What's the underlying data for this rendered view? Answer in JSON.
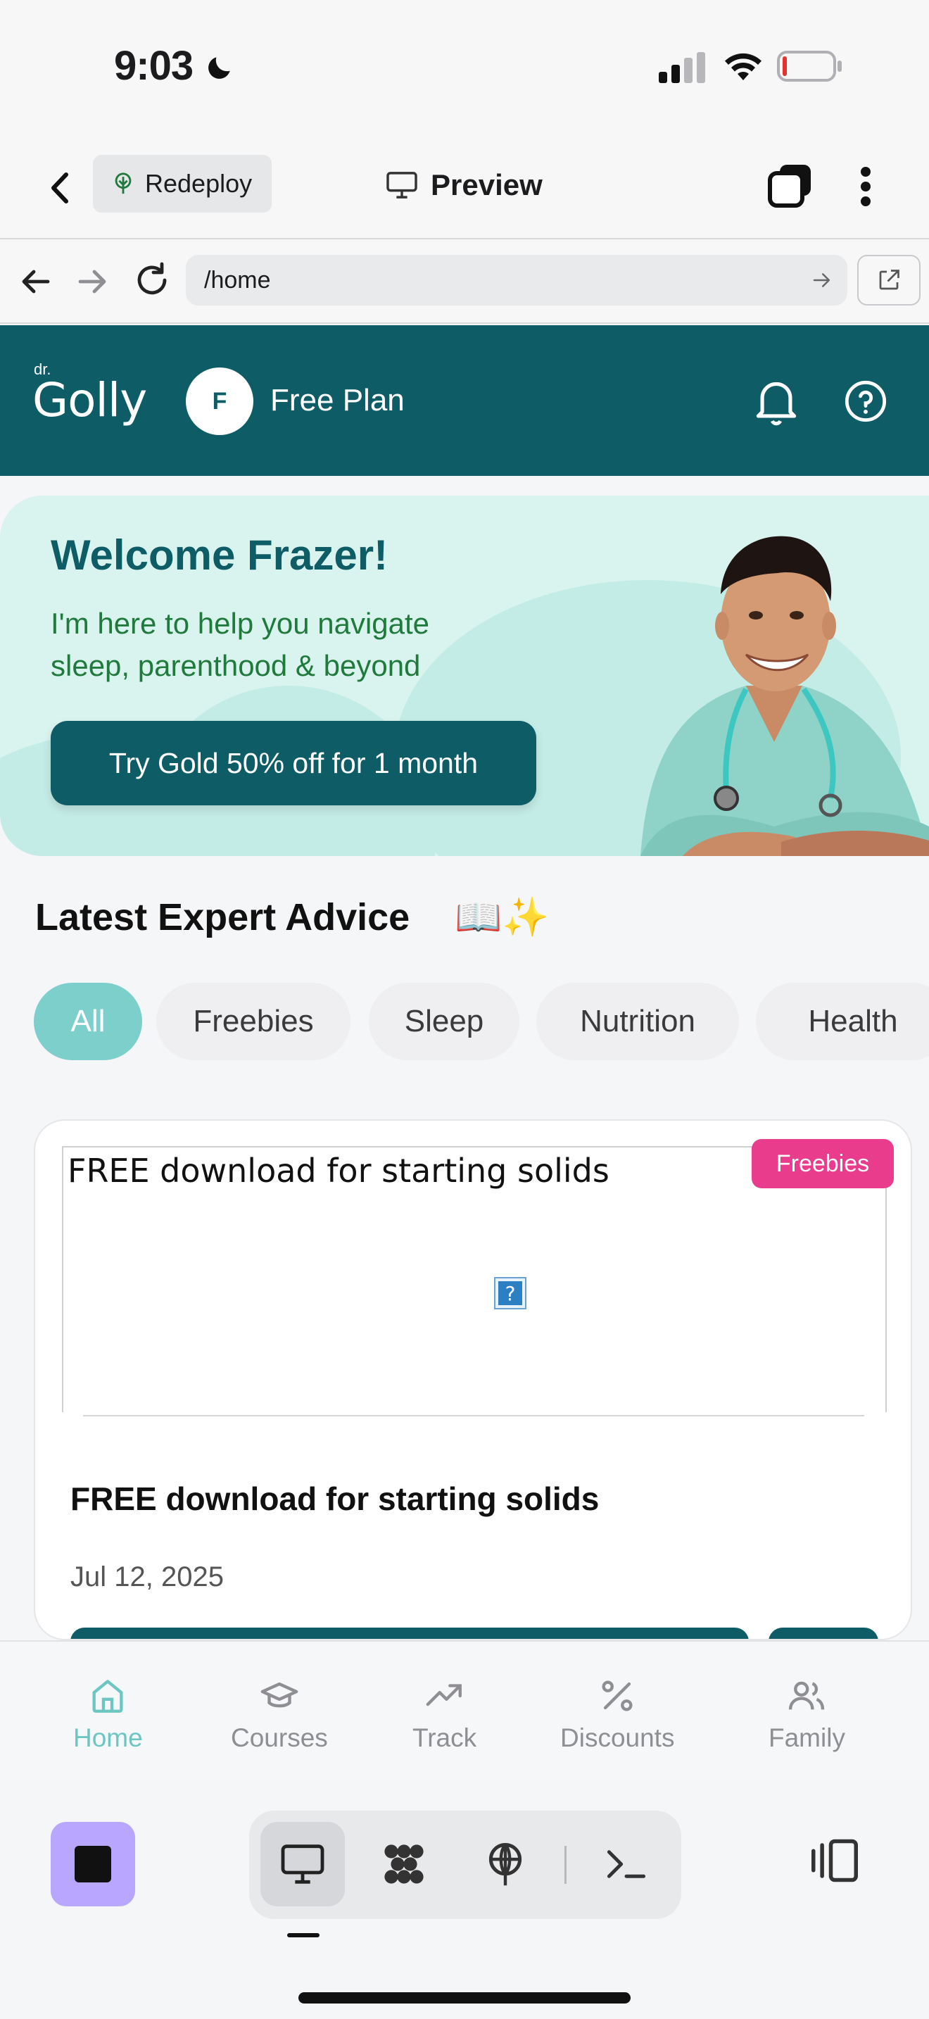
{
  "status_bar": {
    "time": "9:03",
    "moon_icon": "moon-icon",
    "signal_icon": "cellular-signal-icon",
    "wifi_icon": "wifi-icon",
    "battery_icon": "battery-low-icon"
  },
  "toolbar": {
    "back_icon": "chevron-left-icon",
    "redeploy_label": "Redeploy",
    "preview_label": "Preview",
    "tabs_icon": "tabs-icon",
    "more_icon": "more-vertical-icon"
  },
  "browser": {
    "url": "/home"
  },
  "header": {
    "logo_small": "dr.",
    "logo_text": "Golly",
    "avatar_initial": "F",
    "plan": "Free Plan",
    "bell_icon": "bell-icon",
    "help_icon": "help-circle-icon",
    "color": "#0e5c66"
  },
  "banner": {
    "title": "Welcome Frazer!",
    "subtitle": "I'm here to help you navigate sleep, parenthood & beyond",
    "cta": "Try Gold 50% off for 1 month"
  },
  "advice": {
    "title": "Latest Expert Advice",
    "emoji": "📖✨",
    "filters": [
      "All",
      "Freebies",
      "Sleep",
      "Nutrition",
      "Health"
    ],
    "active_filter": "All"
  },
  "card": {
    "image_alt": "FREE download for starting solids",
    "badge": "Freebies",
    "title": "FREE download for starting solids",
    "date": "Jul 12, 2025",
    "badge_color": "#e93c8c"
  },
  "tabs": [
    {
      "label": "Home",
      "icon": "home-icon",
      "active": true
    },
    {
      "label": "Courses",
      "icon": "graduation-cap-icon",
      "active": false
    },
    {
      "label": "Track",
      "icon": "trending-up-icon",
      "active": false
    },
    {
      "label": "Discounts",
      "icon": "percent-icon",
      "active": false
    },
    {
      "label": "Family",
      "icon": "users-icon",
      "active": false
    }
  ],
  "dock": {
    "stop_icon": "stop-icon",
    "preview_icon": "monitor-icon",
    "agent_icon": "agent-icon",
    "deploy_icon": "deploy-icon",
    "shell_icon": "terminal-icon",
    "panel_icon": "panel-toggle-icon"
  }
}
